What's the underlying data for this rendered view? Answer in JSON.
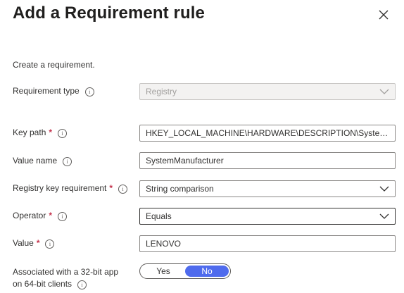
{
  "dialog": {
    "title": "Add a Requirement rule",
    "intro": "Create a requirement."
  },
  "fields": {
    "requirement_type": {
      "label": "Requirement type",
      "value": "Registry"
    },
    "key_path": {
      "label": "Key path",
      "value": "HKEY_LOCAL_MACHINE\\HARDWARE\\DESCRIPTION\\System\\BIOS"
    },
    "value_name": {
      "label": "Value name",
      "value": "SystemManufacturer"
    },
    "registry_key_requirement": {
      "label": "Registry key requirement",
      "value": "String comparison"
    },
    "operator": {
      "label": "Operator",
      "value": "Equals"
    },
    "value": {
      "label": "Value",
      "value": "LENOVO"
    },
    "associated_32bit": {
      "label_line1": "Associated with a 32-bit app",
      "label_line2": "on 64-bit clients",
      "option_yes": "Yes",
      "option_no": "No",
      "selected": "No"
    }
  },
  "required_marker": "*",
  "info_glyph": "i",
  "icons": [
    "close-icon",
    "info-icon",
    "chevron-down-icon"
  ],
  "colors": {
    "accent": "#4f6bed",
    "required": "#c4314b",
    "disabled_bg": "#f3f2f1"
  }
}
